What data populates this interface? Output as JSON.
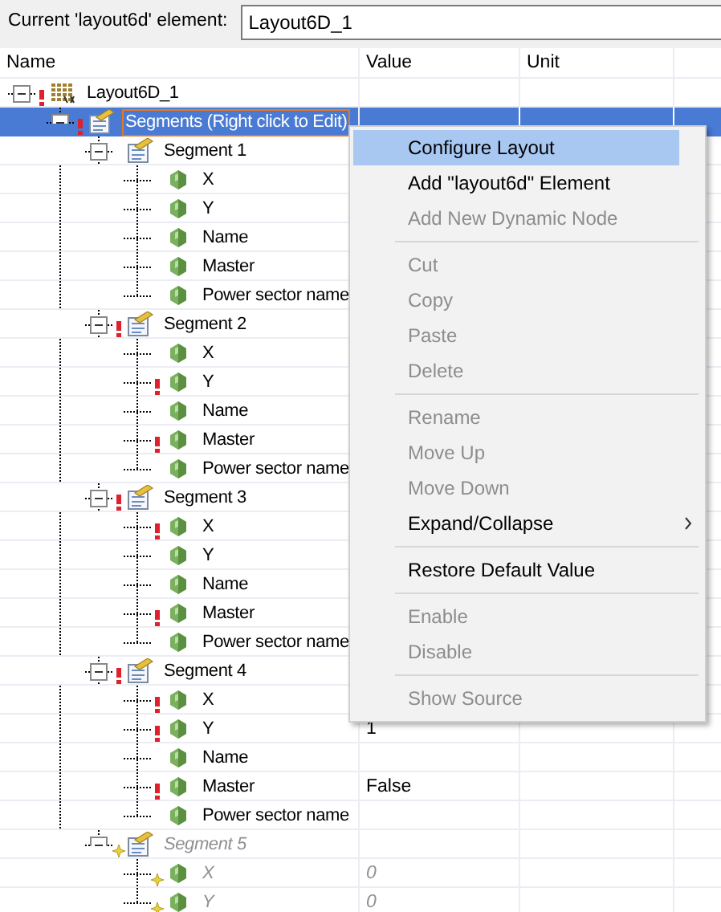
{
  "header": {
    "label": "Current 'layout6d' element:",
    "value": "Layout6D_1"
  },
  "columns": [
    "Name",
    "Value",
    "Unit"
  ],
  "tree": [
    {
      "label": "Layout6D_1",
      "kind": "root",
      "warning": true,
      "dynamic": false,
      "expanded": true,
      "selected": false,
      "children": [
        {
          "label": "Segments (Right click to Edit)",
          "kind": "group",
          "warning": true,
          "dynamic": false,
          "expanded": true,
          "selected": true,
          "children": [
            {
              "label": "Segment 1",
              "kind": "group",
              "warning": false,
              "dynamic": false,
              "expanded": true,
              "selected": false,
              "children": [
                {
                  "label": "X",
                  "kind": "leaf",
                  "warning": false,
                  "dynamic": false,
                  "selected": false
                },
                {
                  "label": "Y",
                  "kind": "leaf",
                  "warning": false,
                  "dynamic": false,
                  "selected": false
                },
                {
                  "label": "Name",
                  "kind": "leaf",
                  "warning": false,
                  "dynamic": false,
                  "selected": false
                },
                {
                  "label": "Master",
                  "kind": "leaf",
                  "warning": false,
                  "dynamic": false,
                  "selected": false
                },
                {
                  "label": "Power sector name",
                  "kind": "leaf",
                  "warning": false,
                  "dynamic": false,
                  "selected": false
                }
              ]
            },
            {
              "label": "Segment 2",
              "kind": "group",
              "warning": true,
              "dynamic": false,
              "expanded": true,
              "selected": false,
              "children": [
                {
                  "label": "X",
                  "kind": "leaf",
                  "warning": false,
                  "dynamic": false,
                  "selected": false
                },
                {
                  "label": "Y",
                  "kind": "leaf",
                  "warning": true,
                  "dynamic": false,
                  "selected": false
                },
                {
                  "label": "Name",
                  "kind": "leaf",
                  "warning": false,
                  "dynamic": false,
                  "selected": false
                },
                {
                  "label": "Master",
                  "kind": "leaf",
                  "warning": true,
                  "dynamic": false,
                  "selected": false
                },
                {
                  "label": "Power sector name",
                  "kind": "leaf",
                  "warning": false,
                  "dynamic": false,
                  "selected": false
                }
              ]
            },
            {
              "label": "Segment 3",
              "kind": "group",
              "warning": true,
              "dynamic": false,
              "expanded": true,
              "selected": false,
              "children": [
                {
                  "label": "X",
                  "kind": "leaf",
                  "warning": true,
                  "dynamic": false,
                  "selected": false
                },
                {
                  "label": "Y",
                  "kind": "leaf",
                  "warning": false,
                  "dynamic": false,
                  "selected": false
                },
                {
                  "label": "Name",
                  "kind": "leaf",
                  "warning": false,
                  "dynamic": false,
                  "selected": false
                },
                {
                  "label": "Master",
                  "kind": "leaf",
                  "warning": true,
                  "dynamic": false,
                  "selected": false
                },
                {
                  "label": "Power sector name",
                  "kind": "leaf",
                  "warning": false,
                  "dynamic": false,
                  "selected": false
                }
              ]
            },
            {
              "label": "Segment 4",
              "kind": "group",
              "warning": true,
              "dynamic": false,
              "expanded": true,
              "selected": false,
              "children": [
                {
                  "label": "X",
                  "kind": "leaf",
                  "warning": true,
                  "dynamic": false,
                  "selected": false
                },
                {
                  "label": "Y",
                  "kind": "leaf",
                  "warning": true,
                  "dynamic": false,
                  "selected": false,
                  "value": "1"
                },
                {
                  "label": "Name",
                  "kind": "leaf",
                  "warning": false,
                  "dynamic": false,
                  "selected": false
                },
                {
                  "label": "Master",
                  "kind": "leaf",
                  "warning": true,
                  "dynamic": false,
                  "selected": false,
                  "value": "False"
                },
                {
                  "label": "Power sector name",
                  "kind": "leaf",
                  "warning": false,
                  "dynamic": false,
                  "selected": false
                }
              ]
            },
            {
              "label": "Segment 5",
              "kind": "group",
              "warning": false,
              "dynamic": true,
              "expanded": true,
              "selected": false,
              "children": [
                {
                  "label": "X",
                  "kind": "leaf",
                  "warning": false,
                  "dynamic": true,
                  "selected": false,
                  "value": "0"
                },
                {
                  "label": "Y",
                  "kind": "leaf",
                  "warning": false,
                  "dynamic": true,
                  "selected": false,
                  "value": "0"
                }
              ]
            }
          ]
        }
      ]
    }
  ],
  "context_menu": [
    {
      "kind": "item",
      "label": "Configure Layout",
      "disabled": false,
      "selected": true
    },
    {
      "kind": "item",
      "label": "Add \"layout6d\" Element",
      "disabled": false,
      "selected": false
    },
    {
      "kind": "item",
      "label": "Add New Dynamic Node",
      "disabled": true,
      "selected": false
    },
    {
      "kind": "separator"
    },
    {
      "kind": "item",
      "label": "Cut",
      "disabled": true,
      "selected": false
    },
    {
      "kind": "item",
      "label": "Copy",
      "disabled": true,
      "selected": false
    },
    {
      "kind": "item",
      "label": "Paste",
      "disabled": true,
      "selected": false
    },
    {
      "kind": "item",
      "label": "Delete",
      "disabled": true,
      "selected": false
    },
    {
      "kind": "separator"
    },
    {
      "kind": "item",
      "label": "Rename",
      "disabled": true,
      "selected": false
    },
    {
      "kind": "item",
      "label": "Move Up",
      "disabled": true,
      "selected": false
    },
    {
      "kind": "item",
      "label": "Move Down",
      "disabled": true,
      "selected": false
    },
    {
      "kind": "submenu",
      "label": "Expand/Collapse",
      "disabled": false,
      "selected": false
    },
    {
      "kind": "separator"
    },
    {
      "kind": "item",
      "label": "Restore Default Value",
      "disabled": false,
      "selected": false
    },
    {
      "kind": "separator"
    },
    {
      "kind": "item",
      "label": "Enable",
      "disabled": true,
      "selected": false
    },
    {
      "kind": "item",
      "label": "Disable",
      "disabled": true,
      "selected": false
    },
    {
      "kind": "separator"
    },
    {
      "kind": "item",
      "label": "Show Source",
      "disabled": true,
      "selected": false
    }
  ]
}
